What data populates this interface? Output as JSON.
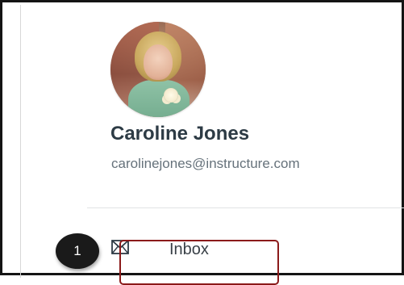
{
  "profile": {
    "name": "Caroline Jones",
    "email": "carolinejones@instructure.com",
    "avatar_icon": "profile-photo"
  },
  "nav": {
    "items": [
      {
        "label": "Inbox",
        "icon": "envelope-icon"
      }
    ]
  },
  "callout": {
    "step_number": "1",
    "highlight_color": "#8b1a1a"
  },
  "colors": {
    "name_text": "#2d3b45",
    "email_text": "#66727b",
    "badge_bg": "#1a1a1a"
  }
}
